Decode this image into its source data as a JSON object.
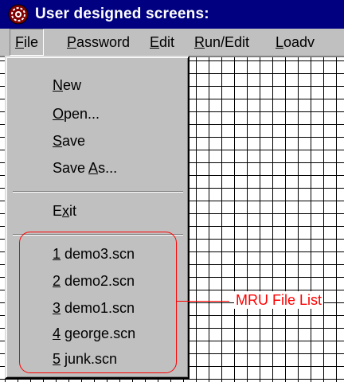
{
  "window": {
    "title": "User designed screens:",
    "icon": "app-gear-icon"
  },
  "menubar": {
    "items": [
      {
        "prefix": "",
        "accel": "F",
        "rest": "ile"
      },
      {
        "prefix": "",
        "accel": "P",
        "rest": "assword"
      },
      {
        "prefix": "",
        "accel": "E",
        "rest": "dit"
      },
      {
        "prefix": "",
        "accel": "R",
        "rest": "un/Edit"
      },
      {
        "prefix": "",
        "accel": "L",
        "rest": "oadv"
      }
    ]
  },
  "file_menu": {
    "items": [
      {
        "prefix": "",
        "accel": "N",
        "rest": "ew"
      },
      {
        "prefix": "",
        "accel": "O",
        "rest": "pen..."
      },
      {
        "prefix": "",
        "accel": "S",
        "rest": "ave"
      },
      {
        "prefix": "Save ",
        "accel": "A",
        "rest": "s..."
      },
      {
        "prefix": "E",
        "accel": "x",
        "rest": "it"
      }
    ],
    "mru": [
      {
        "accel": "1",
        "rest": " demo3.scn"
      },
      {
        "accel": "2",
        "rest": " demo2.scn"
      },
      {
        "accel": "3",
        "rest": " demo1.scn"
      },
      {
        "accel": "4",
        "rest": " george.scn"
      },
      {
        "accel": "5",
        "rest": " junk.scn"
      }
    ]
  },
  "annotation": {
    "label": "MRU File List",
    "color": "#ff0000"
  },
  "colors": {
    "titlebar": "#000080",
    "menu_bg": "#c0c0c0",
    "grid_line": "#000000"
  }
}
